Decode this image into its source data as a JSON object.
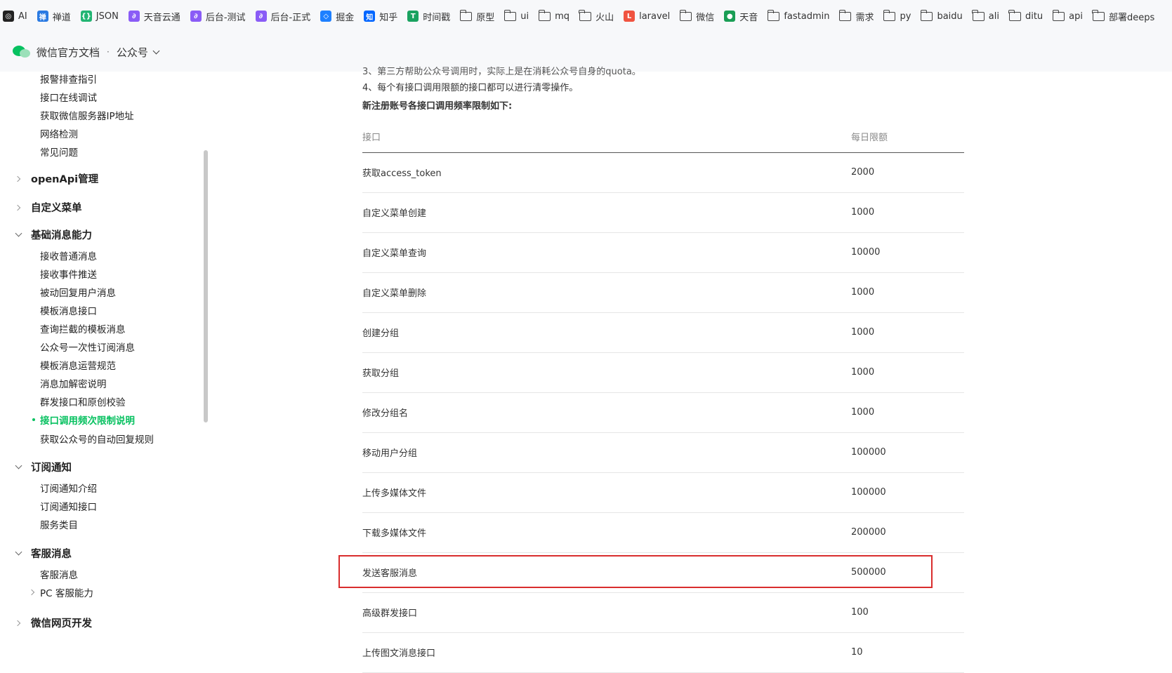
{
  "bookmarks": [
    {
      "label": "AI",
      "icon": "openai-icon",
      "color": "#222222"
    },
    {
      "label": "禅道",
      "icon": "zentao-icon",
      "color": "#2a7ae2"
    },
    {
      "label": "JSON",
      "icon": "json-icon",
      "color": "#22b573"
    },
    {
      "label": "天音云通",
      "icon": "link-icon",
      "color": "#8a5cf6"
    },
    {
      "label": "后台-测试",
      "icon": "link-icon",
      "color": "#8a5cf6"
    },
    {
      "label": "后台-正式",
      "icon": "link-icon",
      "color": "#8a5cf6"
    },
    {
      "label": "掘金",
      "icon": "juejin-icon",
      "color": "#1e80ff"
    },
    {
      "label": "知乎",
      "icon": "zhihu-icon",
      "color": "#0066ff"
    },
    {
      "label": "时间戳",
      "icon": "timestamp-icon",
      "color": "#1aa260"
    },
    {
      "label": "原型",
      "icon": "folder-icon",
      "color": ""
    },
    {
      "label": "ui",
      "icon": "folder-icon",
      "color": ""
    },
    {
      "label": "mq",
      "icon": "folder-icon",
      "color": ""
    },
    {
      "label": "火山",
      "icon": "folder-icon",
      "color": ""
    },
    {
      "label": "laravel",
      "icon": "laravel-icon",
      "color": "#f05340"
    },
    {
      "label": "微信",
      "icon": "folder-icon",
      "color": ""
    },
    {
      "label": "天音",
      "icon": "shield-icon",
      "color": "#1a9e55"
    },
    {
      "label": "fastadmin",
      "icon": "folder-icon",
      "color": ""
    },
    {
      "label": "需求",
      "icon": "folder-icon",
      "color": ""
    },
    {
      "label": "py",
      "icon": "folder-icon",
      "color": ""
    },
    {
      "label": "baidu",
      "icon": "folder-icon",
      "color": ""
    },
    {
      "label": "ali",
      "icon": "folder-icon",
      "color": ""
    },
    {
      "label": "ditu",
      "icon": "folder-icon",
      "color": ""
    },
    {
      "label": "api",
      "icon": "folder-icon",
      "color": ""
    },
    {
      "label": "部署deeps",
      "icon": "folder-icon",
      "color": ""
    }
  ],
  "header": {
    "site_title": "微信官方文档",
    "separator": "·",
    "section": "公众号"
  },
  "sidebar": {
    "top_items": [
      "报警排查指引",
      "接口在线调试",
      "获取微信服务器IP地址",
      "网络检测",
      "常见问题"
    ],
    "groups_collapsed_a": [
      "openApi管理",
      "自定义菜单"
    ],
    "basic_group": "基础消息能力",
    "basic_items": [
      "接收普通消息",
      "接收事件推送",
      "被动回复用户消息",
      "模板消息接口",
      "查询拦截的模板消息",
      "公众号一次性订阅消息",
      "模板消息运营规范",
      "消息加解密说明",
      "群发接口和原创校验",
      "接口调用频次限制说明",
      "获取公众号的自动回复规则"
    ],
    "active_item": "接口调用频次限制说明",
    "subscribe_group": "订阅通知",
    "subscribe_items": [
      "订阅通知介绍",
      "订阅通知接口",
      "服务类目"
    ],
    "kf_group": "客服消息",
    "kf_items": [
      "客服消息",
      "PC 客服能力"
    ],
    "web_group": "微信网页开发"
  },
  "content": {
    "cut_line": "3、第三方帮助公众号调用时，实际上是在消耗公众号自身的quota。",
    "para4": "4、每个有接口调用限额的接口都可以进行清零操作。",
    "table_title": "新注册账号各接口调用频率限制如下:",
    "table_headers": [
      "接口",
      "每日限额"
    ],
    "rows": [
      [
        "获取access_token",
        "2000"
      ],
      [
        "自定义菜单创建",
        "1000"
      ],
      [
        "自定义菜单查询",
        "10000"
      ],
      [
        "自定义菜单删除",
        "1000"
      ],
      [
        "创建分组",
        "1000"
      ],
      [
        "获取分组",
        "1000"
      ],
      [
        "修改分组名",
        "1000"
      ],
      [
        "移动用户分组",
        "100000"
      ],
      [
        "上传多媒体文件",
        "100000"
      ],
      [
        "下载多媒体文件",
        "200000"
      ],
      [
        "发送客服消息",
        "500000"
      ],
      [
        "高级群发接口",
        "100"
      ],
      [
        "上传图文消息接口",
        "10"
      ]
    ],
    "highlighted_row": "发送客服消息"
  },
  "colors": {
    "accent": "#07c160",
    "highlight_border": "#d92d2d"
  }
}
